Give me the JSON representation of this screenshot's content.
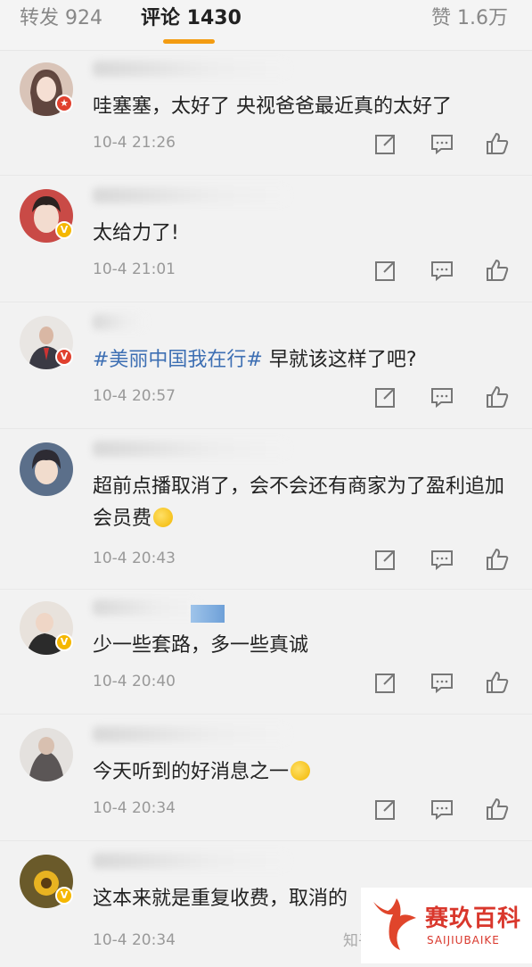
{
  "tabs": {
    "repost": "转发 924",
    "comments": "评论 1430",
    "likes": "赞 1.6万"
  },
  "comments": [
    {
      "text": "哇塞塞，太好了 央视爸爸最近真的太好了",
      "time": "10-4 21:26",
      "badge": "red"
    },
    {
      "text": "太给力了!",
      "time": "10-4 21:01",
      "badge": "gold"
    },
    {
      "topic": "#美丽中国我在行#",
      "text": " 早就该这样了吧?",
      "time": "10-4 20:57",
      "badge": "red"
    },
    {
      "text": "超前点播取消了，会不会还有商家为了盈利追加会员费",
      "time": "10-4 20:43",
      "badge": "none"
    },
    {
      "text": "少一些套路，多一些真诚",
      "time": "10-4 20:40",
      "badge": "gold"
    },
    {
      "text": "今天听到的好消息之一",
      "time": "10-4 20:34",
      "badge": "none"
    },
    {
      "text": "这本来就是重复收费，取消的",
      "time": "10-4 20:34",
      "badge": "gold"
    }
  ],
  "watermark": {
    "title": "赛玖百科",
    "subtitle": "SAIJIUBAIKE",
    "zhihu": "知乎"
  },
  "colors": {
    "accent": "#f39c12",
    "topic": "#3d6fb3",
    "brand_red": "#d9372c"
  }
}
